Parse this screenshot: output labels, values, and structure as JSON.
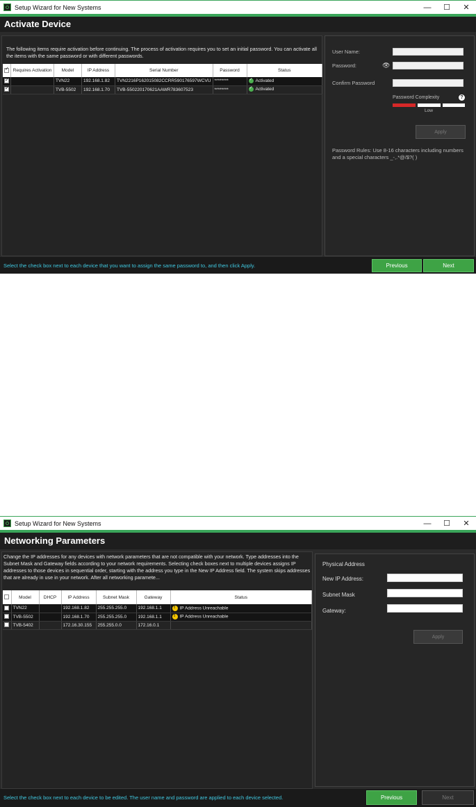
{
  "window1": {
    "title": "Setup Wizard for New Systems",
    "header": "Activate Device",
    "description": "The following items require activation before continuing.  The process of activation requires you to set an initial password. You can activate all the items with the same password or with different passwords.",
    "table": {
      "columns": [
        "",
        "Requires Activation",
        "Model",
        "IP Address",
        "Serial Number",
        "Password",
        "Status"
      ],
      "rows": [
        {
          "checked": true,
          "model": "TVN22",
          "ip": "192.168.1.82",
          "serial": "TVN2216P162015082CCRR590176597WCVU",
          "password": "********",
          "status": "Activated"
        },
        {
          "checked": true,
          "model": "TVB-5502",
          "ip": "192.168.1.70",
          "serial": "TVB-550220170621AAWR783607523",
          "password": "********",
          "status": "Activated"
        }
      ]
    },
    "form": {
      "username_label": "User Name:",
      "password_label": "Password:",
      "confirm_label": "Confirm Password",
      "complexity_label": "Password Complexity",
      "complexity_level": "Low",
      "apply_label": "Apply",
      "rules": "Password Rules: Use 8-16 characters including numbers and a special characters _-,.*@/$?( )"
    },
    "footer_hint": "Select the check box next to each device that you want to assign the same password to, and then click Apply.",
    "previous_label": "Previous",
    "next_label": "Next"
  },
  "window2": {
    "title": "Setup Wizard for New Systems",
    "header": "Networking Parameters",
    "description": "Change the IP addresses for any devices with network parameters that are not compatible with your network. Type addresses into the Subnet Mask and Gateway fields according to your network requirements. Selecting check boxes next to multiple devices assigns IP addresses to those devices in sequential order, starting with the address you type in the New IP Address field. The system skips addresses that are already in use in your network. After all networking paramete...",
    "table": {
      "columns": [
        "",
        "Model",
        "DHCP",
        "IP Address",
        "Subnet Mask",
        "Gateway",
        "Status"
      ],
      "rows": [
        {
          "model": "TVN22",
          "ip": "192.168.1.82",
          "mask": "255.255.255.0",
          "gateway": "192.168.1.1",
          "status": "IP Address Unreachable"
        },
        {
          "model": "TVB-5502",
          "ip": "192.168.1.70",
          "mask": "255.255.255.0",
          "gateway": "192.168.1.1",
          "status": "IP Address Unreachable"
        },
        {
          "model": "TVB-5402",
          "ip": "172.16.30.155",
          "mask": "255.255.0.0",
          "gateway": "172.16.0.1",
          "status": ""
        }
      ]
    },
    "form": {
      "physical_label": "Physical Address",
      "newip_label": "New IP Address:",
      "mask_label": "Subnet Mask",
      "gateway_label": "Gateway:",
      "apply_label": "Apply"
    },
    "footer_hint": "Select the check box next to each device to be edited. The user name and password are applied to each device selected.",
    "previous_label": "Previous",
    "next_label": "Next"
  },
  "colors": {
    "accent": "#3ea345",
    "hint": "#40c8e0",
    "weak": "#d62828"
  }
}
